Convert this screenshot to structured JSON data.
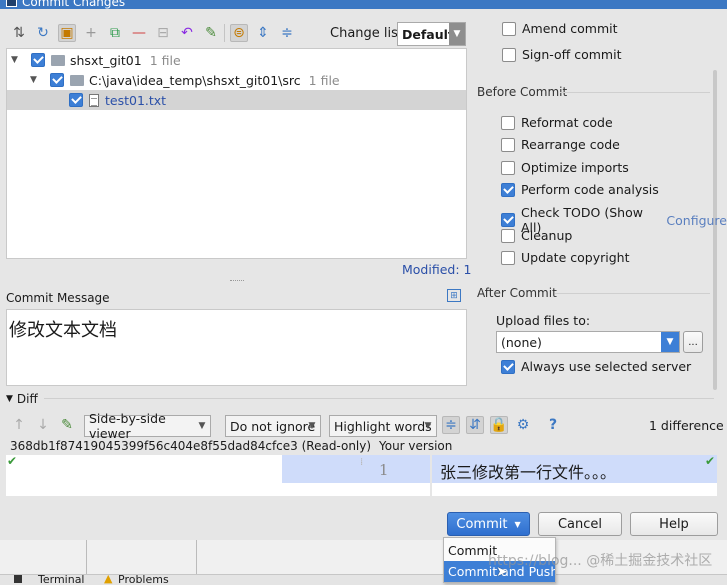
{
  "window": {
    "title": "Commit Changes"
  },
  "toolbar": {
    "icons": [
      "sync-icon",
      "refresh-icon",
      "group-icon",
      "add-icon",
      "move-icon",
      "remove-icon",
      "diff-icon",
      "revert-icon",
      "jump-icon",
      "group-by-icon",
      "expand-all-icon",
      "collapse-all-icon"
    ],
    "changelist_label": "Change list:",
    "changelist_value": "Default"
  },
  "tree": {
    "items": [
      {
        "label": "shsxt_git01",
        "count": "1 file"
      },
      {
        "label": "C:\\java\\idea_temp\\shsxt_git01\\src",
        "count": "1 file"
      },
      {
        "label": "test01.txt"
      }
    ],
    "modified": "Modified: 1"
  },
  "commit_message": {
    "label": "Commit Message",
    "text": "修改文本文档"
  },
  "options": {
    "amend": "Amend commit",
    "signoff": "Sign-off commit",
    "before_title": "Before Commit",
    "before": [
      {
        "label": "Reformat code",
        "checked": false
      },
      {
        "label": "Rearrange code",
        "checked": false
      },
      {
        "label": "Optimize imports",
        "checked": false
      },
      {
        "label": "Perform code analysis",
        "checked": true
      },
      {
        "label": "Check TODO (Show All)",
        "checked": true,
        "link": "Configure"
      },
      {
        "label": "Cleanup",
        "checked": false
      },
      {
        "label": "Update copyright",
        "checked": false
      }
    ],
    "after_title": "After Commit",
    "upload_label": "Upload files to:",
    "upload_value": "(none)",
    "upload_more": "...",
    "always_use": "Always use selected server"
  },
  "diff": {
    "title": "Diff",
    "viewer": "Side-by-side viewer",
    "ignore": "Do not ignore",
    "highlight": "Highlight words",
    "help": "?",
    "differences": "1 difference",
    "left_header": "368db1f87419045399f56c404e8f55dad84cfce3 (Read-only)",
    "right_header": "Your version",
    "line_number": "1",
    "right_line": "张三修改第一行文件。。。"
  },
  "buttons": {
    "commit": "Commit",
    "cancel": "Cancel",
    "help": "Help"
  },
  "commit_menu": {
    "items": [
      "Commit",
      "Commit and Push..."
    ]
  },
  "bottom_tabs": [
    "Terminal",
    "Problems"
  ],
  "watermark": "https://blog... @稀土掘金技术社区",
  "colors": {
    "accent": "#3d7fd6",
    "diff_highlight": "#cfdcfa",
    "titlebar": "#3c78c3"
  }
}
